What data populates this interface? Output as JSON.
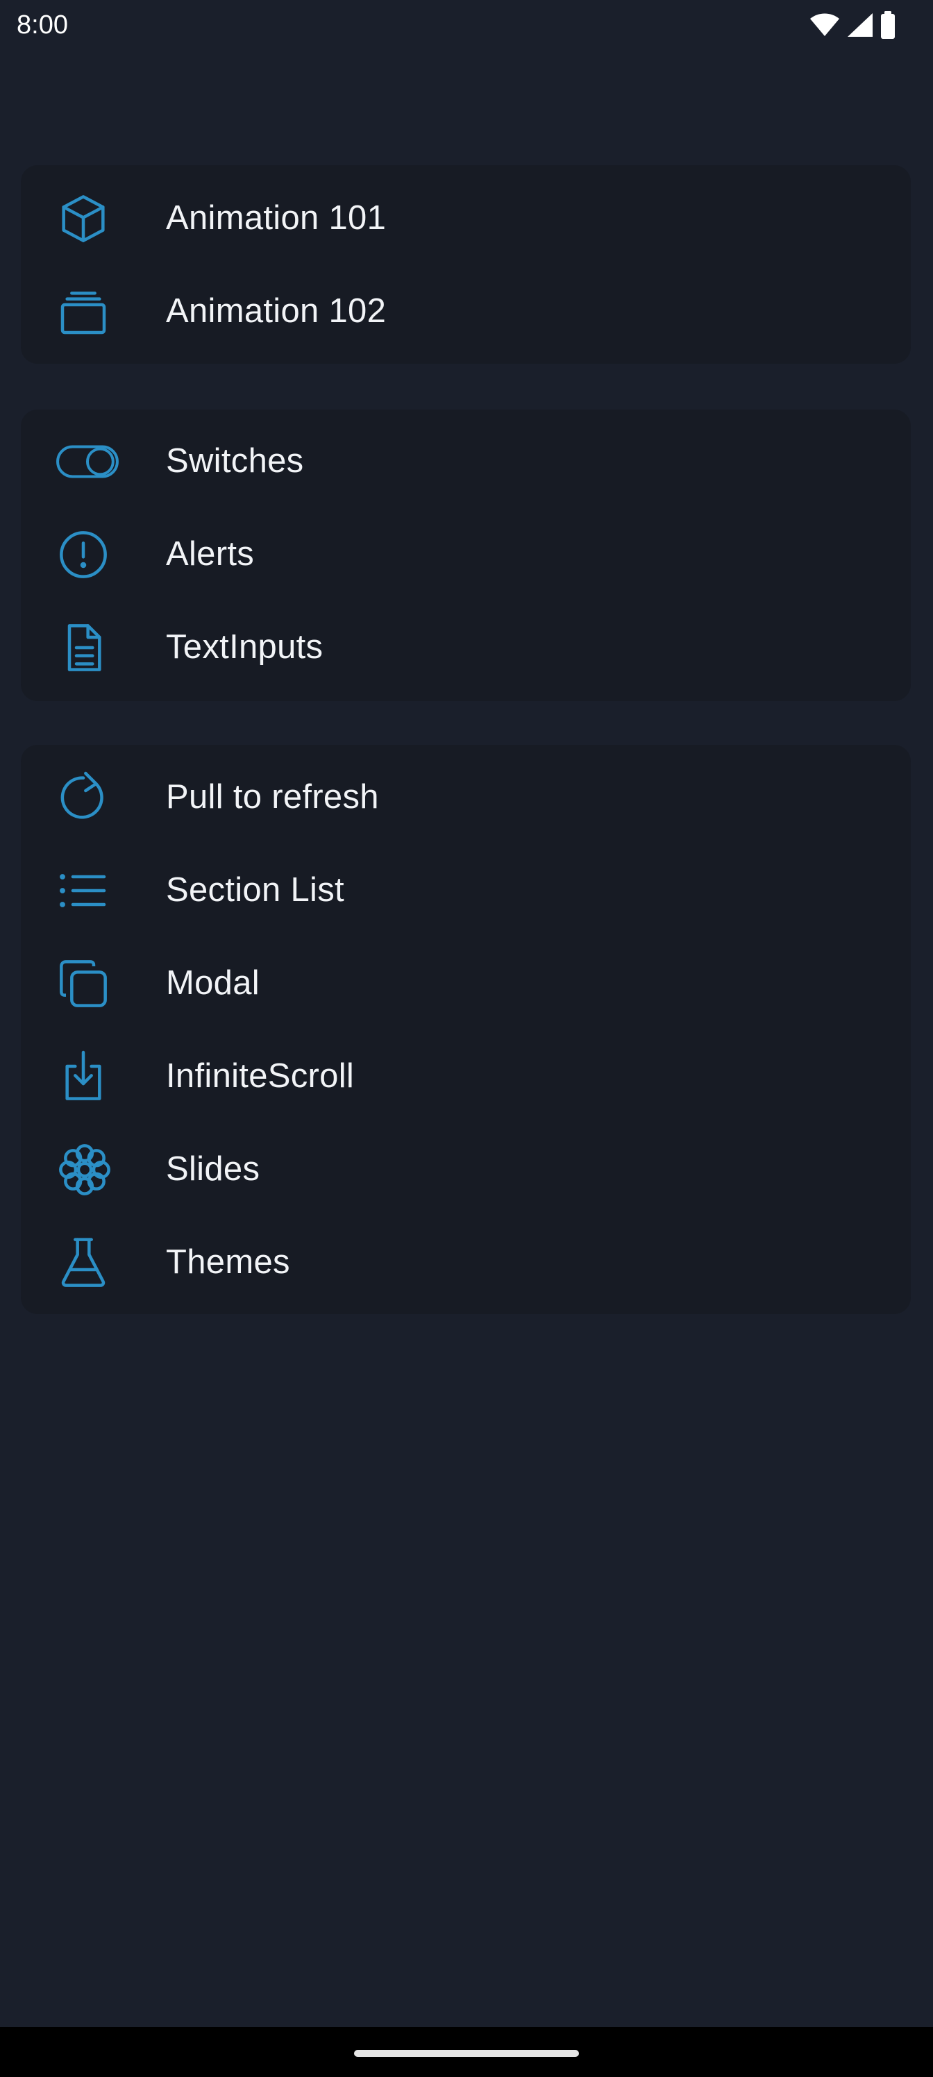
{
  "status_bar": {
    "time": "8:00",
    "icons": [
      "wifi-icon",
      "cell-signal-icon",
      "battery-icon"
    ]
  },
  "colors": {
    "background": "#1a1f2b",
    "card": "#171b24",
    "accent": "#2b8fc6",
    "text": "#f2f4f7"
  },
  "groups": [
    {
      "items": [
        {
          "label": "Animation 101",
          "icon": "cube-icon"
        },
        {
          "label": "Animation 102",
          "icon": "stack-icon"
        }
      ]
    },
    {
      "items": [
        {
          "label": "Switches",
          "icon": "toggle-icon"
        },
        {
          "label": "Alerts",
          "icon": "alert-circle-icon"
        },
        {
          "label": "TextInputs",
          "icon": "document-icon"
        }
      ]
    },
    {
      "items": [
        {
          "label": "Pull to refresh",
          "icon": "refresh-icon"
        },
        {
          "label": "Section List",
          "icon": "list-icon"
        },
        {
          "label": "Modal",
          "icon": "copy-icon"
        },
        {
          "label": "InfiniteScroll",
          "icon": "download-icon"
        },
        {
          "label": "Slides",
          "icon": "flower-icon"
        },
        {
          "label": "Themes",
          "icon": "flask-icon"
        }
      ]
    }
  ]
}
